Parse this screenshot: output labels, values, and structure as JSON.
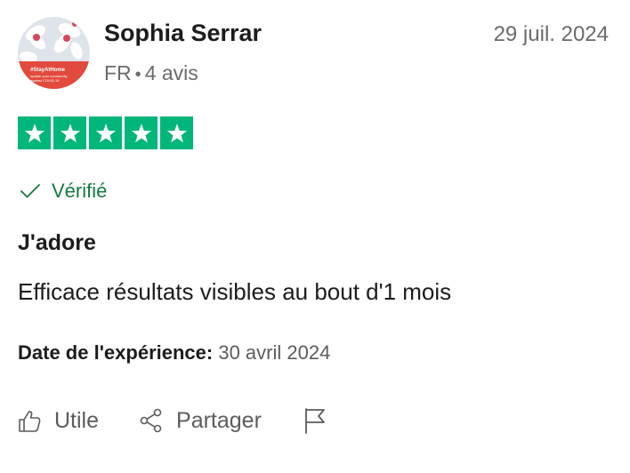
{
  "reviewer": {
    "name": "Sophia Serrar",
    "country": "FR",
    "separator": "•",
    "review_count": "4 avis",
    "avatar_text_line1": "#StayAtHome",
    "avatar_text_line2": "update your community",
    "avatar_text_line3": "against COVID-19"
  },
  "review": {
    "date": "29 juil. 2024",
    "rating": 5,
    "verified_label": "Vérifié",
    "title": "J'adore",
    "body": "Efficace résultats visibles au bout d'1 mois",
    "experience_label": "Date de l'expérience:",
    "experience_date": "30 avril 2024"
  },
  "actions": {
    "useful_label": "Utile",
    "share_label": "Partager"
  },
  "colors": {
    "star_green": "#00b67a",
    "verified_green": "#137a3e",
    "text_dark": "#1c1c1c",
    "text_muted": "#6b6b6b"
  },
  "icons": {
    "avatar": "profile-photo",
    "star": "star-icon",
    "verified": "checkmark-icon",
    "useful": "thumbs-up-icon",
    "share": "share-icon",
    "report": "flag-icon"
  }
}
